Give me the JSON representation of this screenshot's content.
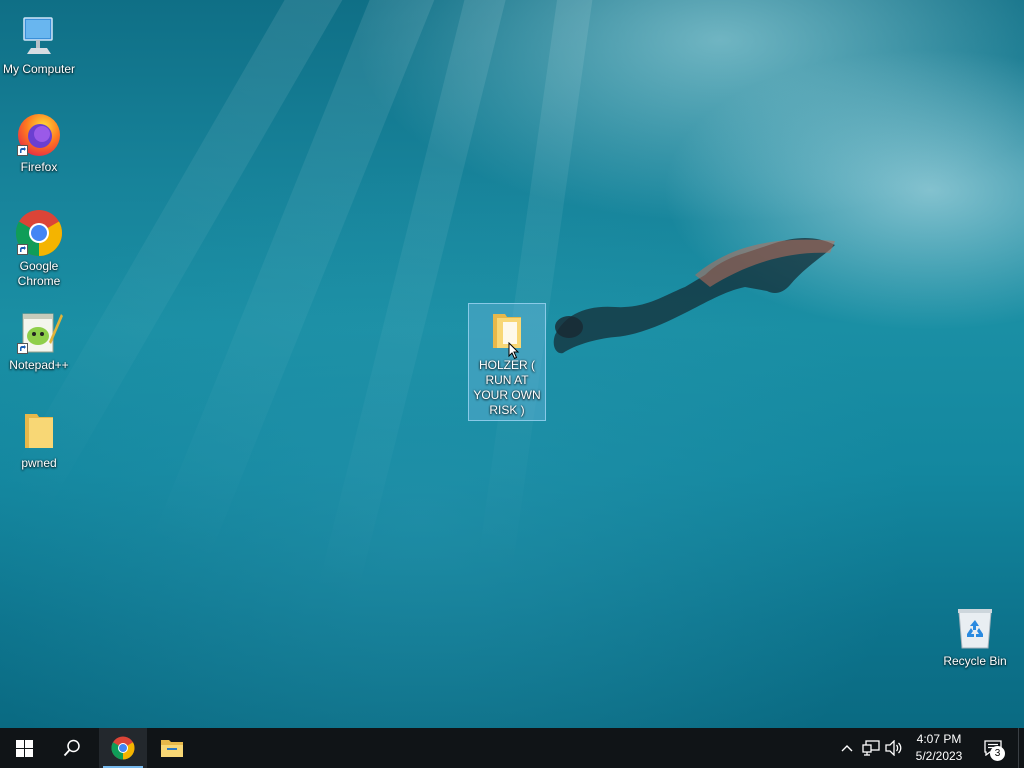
{
  "desktop": {
    "icons": [
      {
        "label": "My Computer",
        "icon": "computer-icon",
        "shortcut": false
      },
      {
        "label": "Firefox",
        "icon": "firefox-icon",
        "shortcut": true
      },
      {
        "label": "Google Chrome",
        "icon": "chrome-icon",
        "shortcut": true
      },
      {
        "label": "Notepad++",
        "icon": "notepadpp-icon",
        "shortcut": true
      },
      {
        "label": "pwned",
        "icon": "folder-icon",
        "shortcut": false
      },
      {
        "label": "HOLZER ( RUN AT YOUR OWN RISK )",
        "icon": "folder-icon",
        "shortcut": false,
        "selected": true
      },
      {
        "label": "Recycle Bin",
        "icon": "recycle-bin-icon",
        "shortcut": false
      }
    ]
  },
  "taskbar": {
    "start": {
      "icon": "windows-logo-icon"
    },
    "search": {
      "icon": "search-icon"
    },
    "pinned": [
      {
        "name": "Google Chrome",
        "icon": "chrome-icon",
        "active": true
      },
      {
        "name": "File Explorer",
        "icon": "file-explorer-icon",
        "active": false
      }
    ],
    "tray": {
      "icons": [
        "chevron-up-icon",
        "network-icon",
        "volume-icon"
      ],
      "clock": {
        "time": "4:07 PM",
        "date": "5/2/2023"
      },
      "notifications": {
        "icon": "action-center-icon",
        "count": "3"
      }
    },
    "accent_color": "#76b9ed"
  }
}
